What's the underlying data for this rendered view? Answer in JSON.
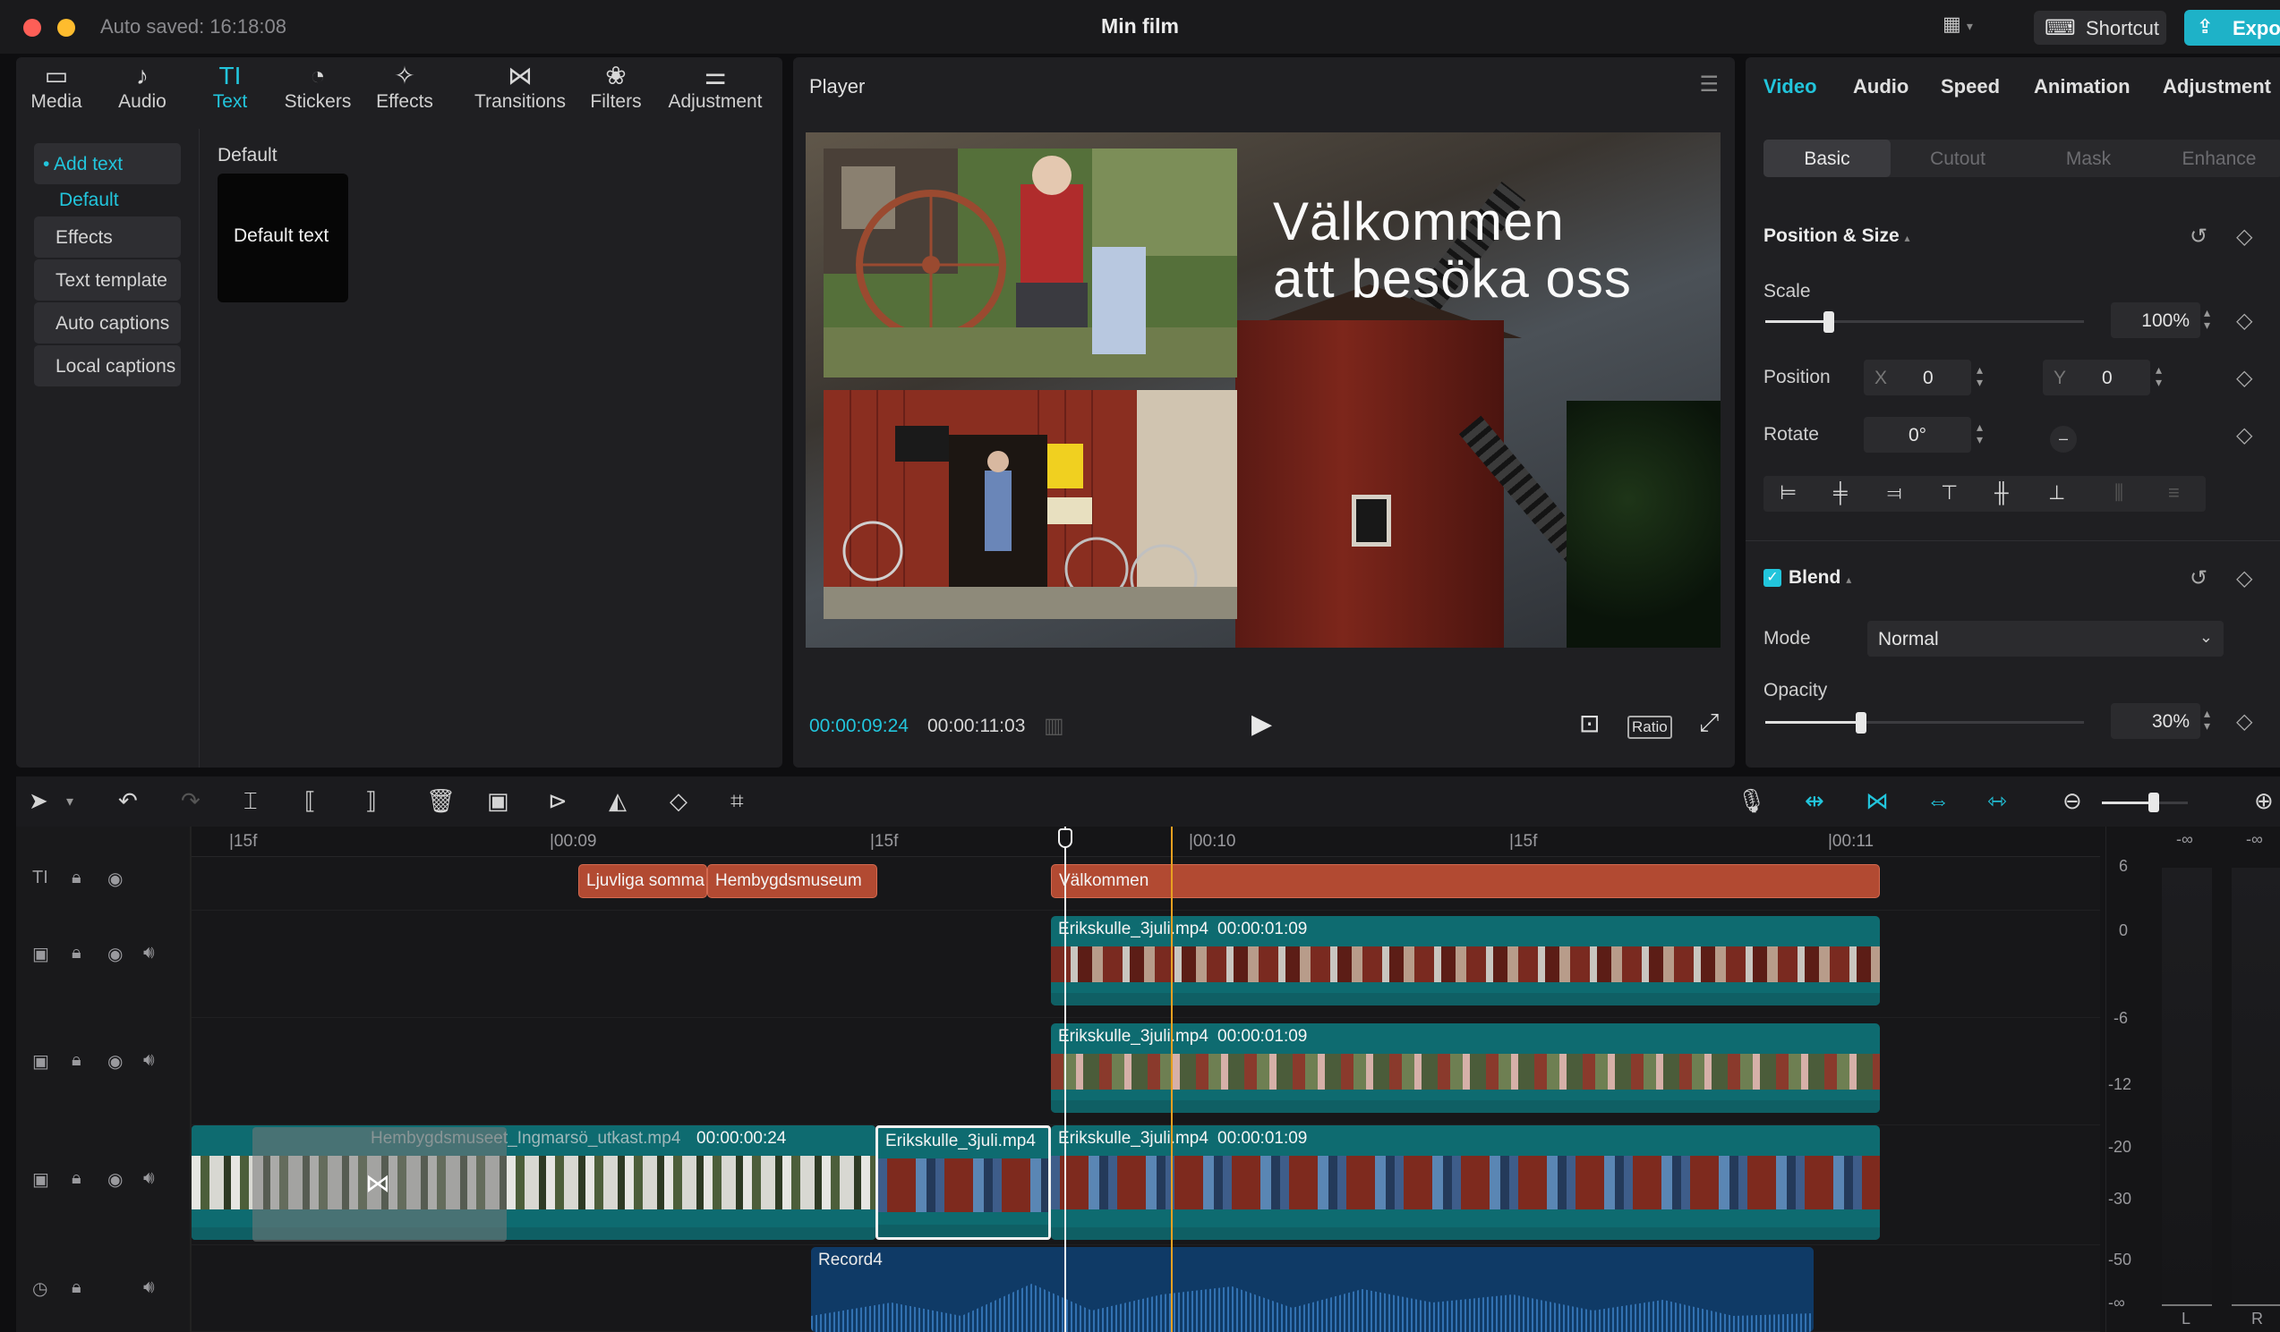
{
  "titlebar": {
    "autosave": "Auto saved: 16:18:08",
    "title": "Min film",
    "shortcut": "Shortcut",
    "export": "Export"
  },
  "left_toolbar": [
    {
      "label": "Media",
      "icon": "media-icon",
      "glyph": "▭"
    },
    {
      "label": "Audio",
      "icon": "audio-icon",
      "glyph": "♪"
    },
    {
      "label": "Text",
      "icon": "text-icon",
      "glyph": "TI"
    },
    {
      "label": "Stickers",
      "icon": "stickers-icon",
      "glyph": "◔"
    },
    {
      "label": "Effects",
      "icon": "effects-icon",
      "glyph": "✧"
    },
    {
      "label": "Transitions",
      "icon": "transitions-icon",
      "glyph": "⋈"
    },
    {
      "label": "Filters",
      "icon": "filters-icon",
      "glyph": "❀"
    },
    {
      "label": "Adjustment",
      "icon": "adjustment-icon",
      "glyph": "⚌"
    }
  ],
  "text_sidebar": {
    "add_text": "• Add text",
    "items": [
      "Default",
      "Effects",
      "Text template",
      "Auto captions",
      "Local captions"
    ]
  },
  "text_panel": {
    "section_title": "Default",
    "card_label": "Default text"
  },
  "player": {
    "title": "Player",
    "overlay_line1": "Välkommen",
    "overlay_line2": "att besöka oss",
    "current_time": "00:00:09:24",
    "total_time": "00:00:11:03",
    "ratio": "Ratio"
  },
  "inspector": {
    "tabs": [
      "Video",
      "Audio",
      "Speed",
      "Animation",
      "Adjustment"
    ],
    "subtabs": [
      "Basic",
      "Cutout",
      "Mask",
      "Enhance"
    ],
    "position_size": "Position & Size",
    "scale_label": "Scale",
    "scale_value": "100%",
    "scale_fraction": 0.2,
    "position_label": "Position",
    "x_label": "X",
    "x_value": "0",
    "y_label": "Y",
    "y_value": "0",
    "rotate_label": "Rotate",
    "rotate_value": "0°",
    "blend_label": "Blend",
    "mode_label": "Mode",
    "mode_value": "Normal",
    "opacity_label": "Opacity",
    "opacity_value": "30%",
    "opacity_fraction": 0.3
  },
  "timeline": {
    "ruler": [
      "|15f",
      "|00:09",
      "|15f",
      "|00:10",
      "|15f",
      "|00:11"
    ],
    "text_clips": [
      "Ljuvliga somma",
      "Hembygdsmuseum",
      "Välkommen"
    ],
    "overlay_clip_1": {
      "name": "Erikskulle_3juli.mp4",
      "duration": "00:00:01:09"
    },
    "overlay_clip_2": {
      "name": "Erikskulle_3juli.mp4",
      "duration": "00:00:01:09"
    },
    "main_clip_a": {
      "name": "Hembygdsmuseet_Ingmarsö_utkast.mp4",
      "duration": "00:00:00:24"
    },
    "main_clip_b": {
      "name": "Erikskulle_3juli.mp4"
    },
    "main_clip_c": {
      "name": "Erikskulle_3juli.mp4",
      "duration": "00:00:01:09"
    },
    "audio_clip": "Record4",
    "zoom_fraction": 0.6
  },
  "meter": {
    "top": [
      "-∞",
      "-∞"
    ],
    "scale": [
      "6",
      "0",
      "-6",
      "-12",
      "-20",
      "-30",
      "-50",
      "-∞"
    ],
    "channels": [
      "L",
      "R"
    ]
  },
  "colors": {
    "accent": "#22c5dc",
    "text_clip": "#b24a32",
    "video_clip": "#0e6b70",
    "audio_clip": "#0f3a66",
    "playhead_marker": "#e8a020"
  }
}
